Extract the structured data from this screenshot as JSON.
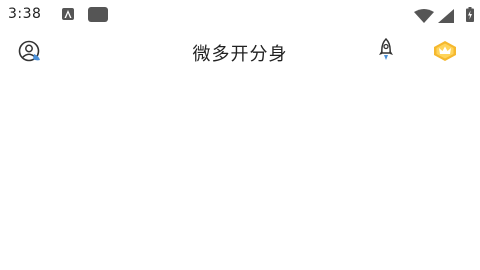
{
  "status_bar": {
    "time": "3:38",
    "icons": [
      "notification-a-icon",
      "notification-box-icon",
      "wifi-icon",
      "cell-signal-icon",
      "battery-charging-icon"
    ]
  },
  "header": {
    "title": "微多开分身",
    "left_icon": "user-avatar-icon",
    "right_icons": [
      "rocket-icon",
      "vip-crown-icon"
    ]
  },
  "colors": {
    "status_icon": "#555555",
    "avatar_accent": "#4a90d9",
    "vip_gold": "#f5b82e"
  }
}
